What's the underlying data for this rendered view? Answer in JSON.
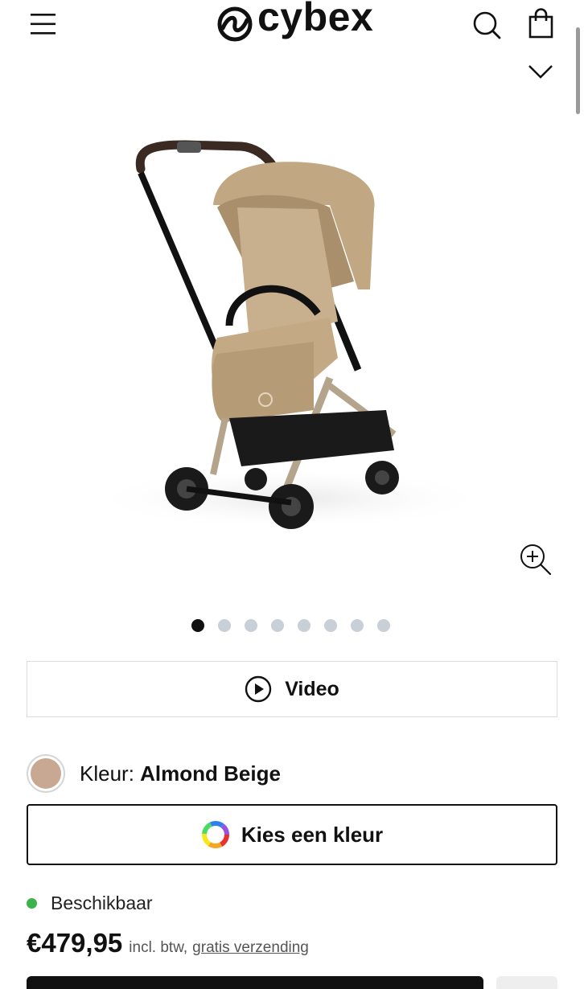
{
  "header": {
    "logo_text": "cybex",
    "icons": {
      "menu": "menu-icon",
      "search": "search-icon",
      "bag": "shopping-bag-icon",
      "chevron": "chevron-down-icon"
    }
  },
  "gallery": {
    "image_subject": "stroller-product-photo",
    "zoom_icon": "zoom-in-icon",
    "slide_count": 8,
    "active_slide": 1
  },
  "video": {
    "label": "Video",
    "icon": "play-icon"
  },
  "color": {
    "prefix": "Kleur:",
    "name": "Almond Beige",
    "swatch_hex": "#c8a892"
  },
  "choose_color": {
    "label": "Kies een kleur",
    "icon": "color-wheel-icon"
  },
  "stock": {
    "text": "Beschikbaar",
    "dot_color": "#3cb44b"
  },
  "pricing": {
    "price": "€479,95",
    "note": "incl. btw,",
    "shipping": "gratis verzending"
  },
  "colors": {
    "text": "#111111",
    "border": "#dcdcdc",
    "dot_inactive": "#c8cfd6",
    "dot_active": "#111111"
  }
}
